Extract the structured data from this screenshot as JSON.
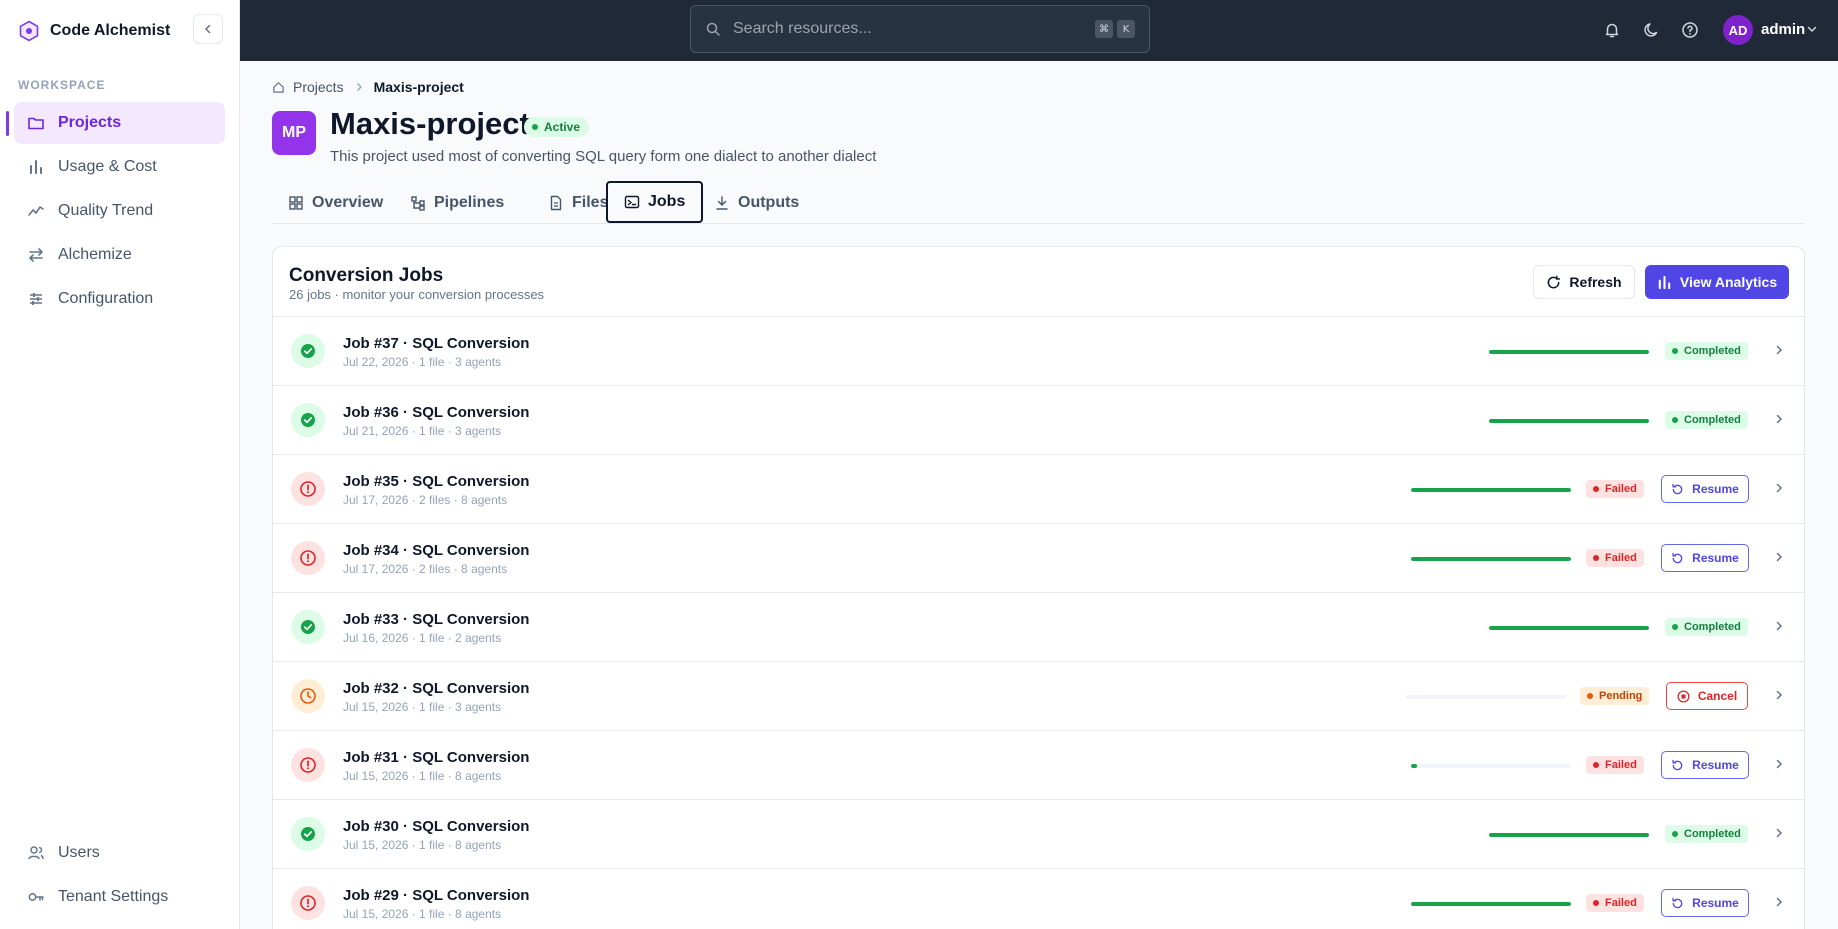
{
  "app": {
    "name": "Code Alchemist"
  },
  "sidebar": {
    "section_label": "WORKSPACE",
    "items": [
      {
        "label": "Projects",
        "icon": "folder-icon",
        "active": true
      },
      {
        "label": "Usage & Cost",
        "icon": "bar-chart-icon"
      },
      {
        "label": "Quality Trend",
        "icon": "trend-icon"
      },
      {
        "label": "Alchemize",
        "icon": "swap-icon"
      },
      {
        "label": "Configuration",
        "icon": "sliders-icon"
      }
    ],
    "bottom_items": [
      {
        "label": "Users",
        "icon": "users-icon"
      },
      {
        "label": "Tenant Settings",
        "icon": "key-icon"
      }
    ]
  },
  "topbar": {
    "search_placeholder": "Search resources...",
    "shortcut": [
      "⌘",
      "K"
    ],
    "user_initials": "AD",
    "user_name": "admin"
  },
  "breadcrumb": {
    "root": "Projects",
    "current": "Maxis-project"
  },
  "project": {
    "initials": "MP",
    "name": "Maxis-project",
    "status": "Active",
    "description": "This project used most of converting SQL query form one dialect to another dialect"
  },
  "tabs": [
    {
      "label": "Overview",
      "icon": "grid-icon"
    },
    {
      "label": "Pipelines",
      "icon": "pipeline-icon"
    },
    {
      "label": "Files",
      "icon": "file-icon"
    },
    {
      "label": "Jobs",
      "icon": "terminal-icon",
      "active": true
    },
    {
      "label": "Outputs",
      "icon": "download-icon"
    }
  ],
  "jobs_card": {
    "title": "Conversion Jobs",
    "subtitle": "26 jobs · monitor your conversion processes",
    "refresh_label": "Refresh",
    "analytics_label": "View Analytics"
  },
  "jobs": [
    {
      "title": "Job #37 · SQL Conversion",
      "meta": "Jul 22, 2026 · 1 file · 3 agents",
      "status": "Completed",
      "state": "ok",
      "progress": 100
    },
    {
      "title": "Job #36 · SQL Conversion",
      "meta": "Jul 21, 2026 · 1 file · 3 agents",
      "status": "Completed",
      "state": "ok",
      "progress": 100
    },
    {
      "title": "Job #35 · SQL Conversion",
      "meta": "Jul 17, 2026 · 2 files · 8 agents",
      "status": "Failed",
      "state": "fail",
      "progress": 100,
      "action": "Resume"
    },
    {
      "title": "Job #34 · SQL Conversion",
      "meta": "Jul 17, 2026 · 2 files · 8 agents",
      "status": "Failed",
      "state": "fail",
      "progress": 100,
      "action": "Resume"
    },
    {
      "title": "Job #33 · SQL Conversion",
      "meta": "Jul 16, 2026 · 1 file · 2 agents",
      "status": "Completed",
      "state": "ok",
      "progress": 100
    },
    {
      "title": "Job #32 · SQL Conversion",
      "meta": "Jul 15, 2026 · 1 file · 3 agents",
      "status": "Pending",
      "state": "pend",
      "progress": 0,
      "action": "Cancel"
    },
    {
      "title": "Job #31 · SQL Conversion",
      "meta": "Jul 15, 2026 · 1 file · 8 agents",
      "status": "Failed",
      "state": "fail",
      "progress": 4,
      "action": "Resume"
    },
    {
      "title": "Job #30 · SQL Conversion",
      "meta": "Jul 15, 2026 · 1 file · 8 agents",
      "status": "Completed",
      "state": "ok",
      "progress": 100
    },
    {
      "title": "Job #29 · SQL Conversion",
      "meta": "Jul 15, 2026 · 1 file · 8 agents",
      "status": "Failed",
      "state": "fail",
      "progress": 100,
      "action": "Resume"
    }
  ],
  "colors": {
    "accent": "#4f46e5",
    "brand": "#7c3aed",
    "success": "#16a34a",
    "danger": "#dc2626",
    "warning": "#ea580c"
  }
}
